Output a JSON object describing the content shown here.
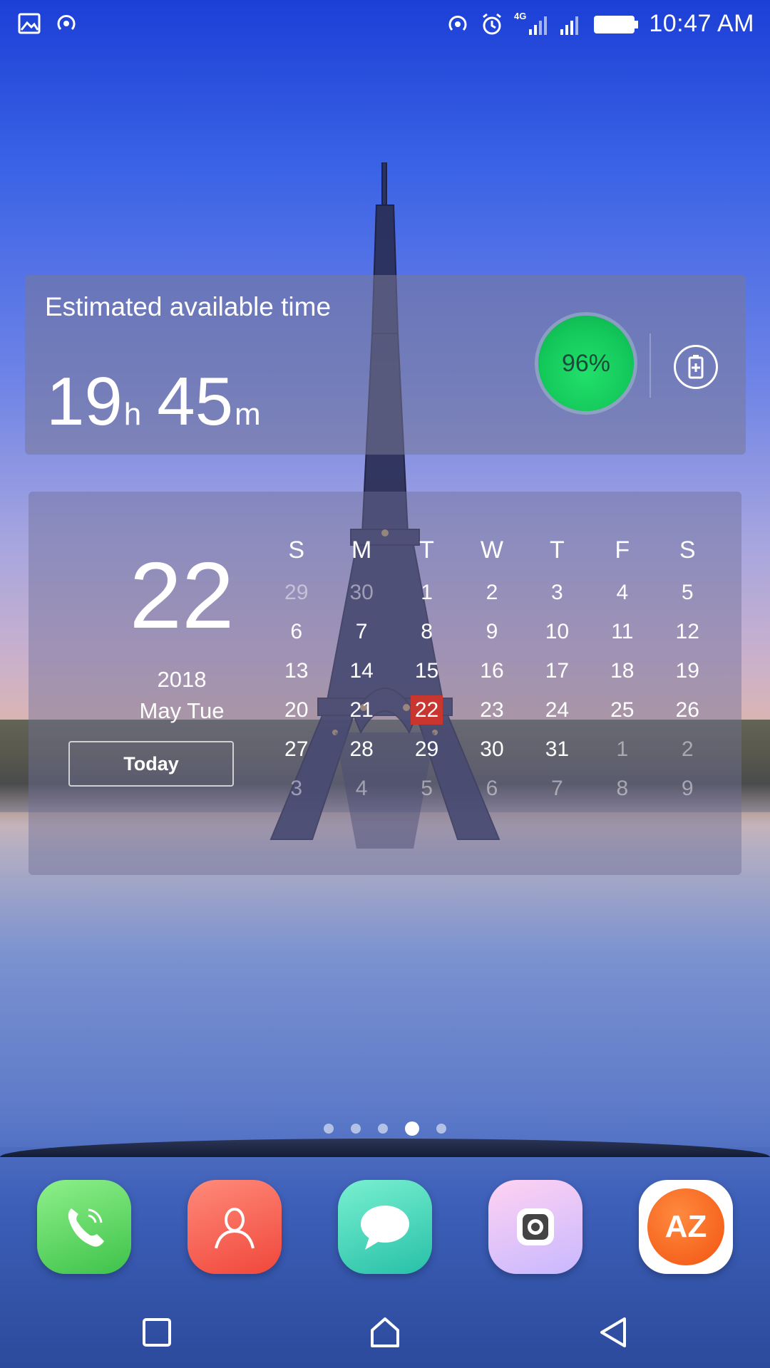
{
  "status_bar": {
    "time": "10:47 AM",
    "network_label": "4G",
    "icons": [
      "gallery-icon",
      "hotspot-icon",
      "hotspot-icon",
      "alarm-icon",
      "signal-icon",
      "signal-icon",
      "battery-icon"
    ]
  },
  "battery_widget": {
    "label": "Estimated available time",
    "hours": "19",
    "hours_unit": "h",
    "minutes": "45",
    "minutes_unit": "m",
    "percent_text": "96%",
    "percent_value": 96
  },
  "calendar_widget": {
    "day": "22",
    "year": "2018",
    "month_weekday": "May Tue",
    "today_label": "Today",
    "weekday_headers": [
      "S",
      "M",
      "T",
      "W",
      "T",
      "F",
      "S"
    ],
    "weeks": [
      [
        {
          "d": "29",
          "m": true
        },
        {
          "d": "30",
          "m": true
        },
        {
          "d": "1"
        },
        {
          "d": "2"
        },
        {
          "d": "3"
        },
        {
          "d": "4"
        },
        {
          "d": "5"
        }
      ],
      [
        {
          "d": "6"
        },
        {
          "d": "7"
        },
        {
          "d": "8"
        },
        {
          "d": "9"
        },
        {
          "d": "10"
        },
        {
          "d": "11"
        },
        {
          "d": "12"
        }
      ],
      [
        {
          "d": "13"
        },
        {
          "d": "14"
        },
        {
          "d": "15"
        },
        {
          "d": "16"
        },
        {
          "d": "17"
        },
        {
          "d": "18"
        },
        {
          "d": "19"
        }
      ],
      [
        {
          "d": "20"
        },
        {
          "d": "21"
        },
        {
          "d": "22",
          "sel": true
        },
        {
          "d": "23"
        },
        {
          "d": "24"
        },
        {
          "d": "25"
        },
        {
          "d": "26"
        }
      ],
      [
        {
          "d": "27"
        },
        {
          "d": "28"
        },
        {
          "d": "29"
        },
        {
          "d": "30"
        },
        {
          "d": "31"
        },
        {
          "d": "1",
          "m": true
        },
        {
          "d": "2",
          "m": true
        }
      ],
      [
        {
          "d": "3",
          "m": true
        },
        {
          "d": "4",
          "m": true
        },
        {
          "d": "5",
          "m": true
        },
        {
          "d": "6",
          "m": true
        },
        {
          "d": "7",
          "m": true
        },
        {
          "d": "8",
          "m": true
        },
        {
          "d": "9",
          "m": true
        }
      ]
    ]
  },
  "pager": {
    "count": 5,
    "active_index": 3
  },
  "dock": {
    "apps": [
      {
        "name": "phone",
        "icon": "phone-icon"
      },
      {
        "name": "contacts",
        "icon": "contacts-icon"
      },
      {
        "name": "messages",
        "icon": "messages-icon"
      },
      {
        "name": "camera",
        "icon": "camera-icon"
      },
      {
        "name": "tools",
        "icon": "az-icon",
        "icon_text": "AZ"
      }
    ]
  },
  "navigation": {
    "buttons": [
      "recents-icon",
      "home-icon",
      "back-icon"
    ]
  },
  "colors": {
    "selected_day": "#c8362f",
    "battery_ring": "#13c85a"
  }
}
